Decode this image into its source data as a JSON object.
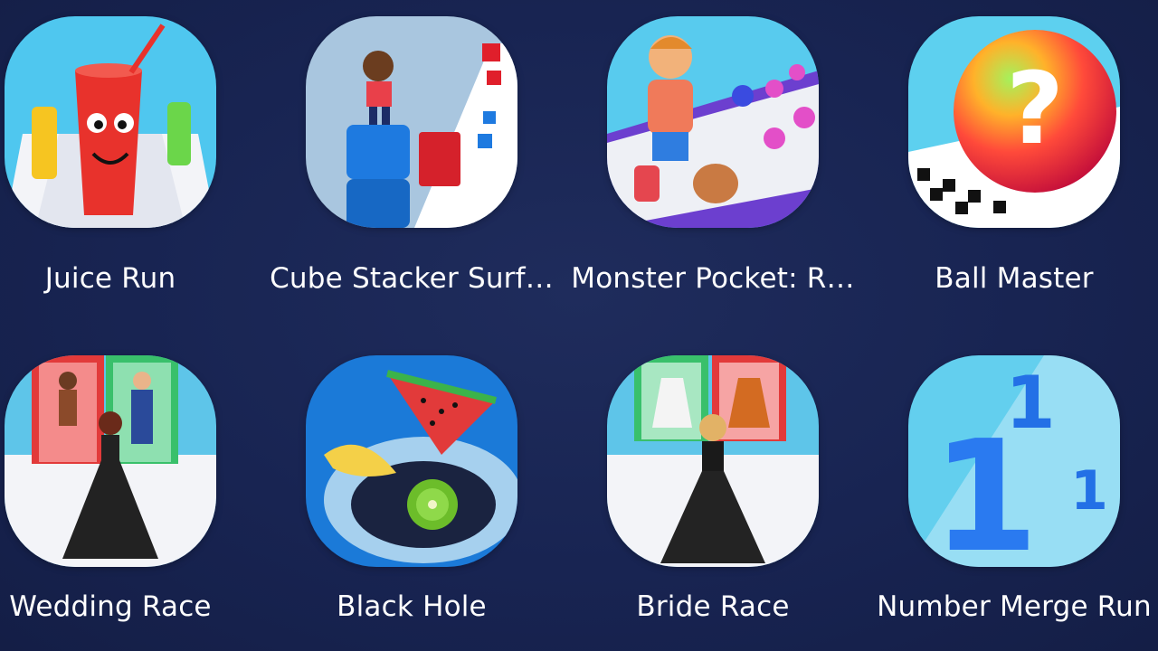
{
  "apps": [
    {
      "label": "Juice Run",
      "icon": "juice-glass-icon",
      "accent": "#e8322c"
    },
    {
      "label": "Cube Stacker Surf…",
      "icon": "cube-stack-icon",
      "accent": "#1e7ae0"
    },
    {
      "label": "Monster Pocket: R…",
      "icon": "monster-runner-icon",
      "accent": "#f07a5a"
    },
    {
      "label": "Ball Master",
      "icon": "rainbow-ball-icon",
      "accent": "#e92a3f"
    },
    {
      "label": "Wedding Race",
      "icon": "wedding-bride-icon",
      "accent": "#222222"
    },
    {
      "label": "Black Hole",
      "icon": "black-hole-fruit-icon",
      "accent": "#1b7ad8"
    },
    {
      "label": "Bride Race",
      "icon": "bride-dress-icon",
      "accent": "#222222"
    },
    {
      "label": "Number Merge Run",
      "icon": "number-merge-icon",
      "accent": "#2370e6"
    }
  ]
}
